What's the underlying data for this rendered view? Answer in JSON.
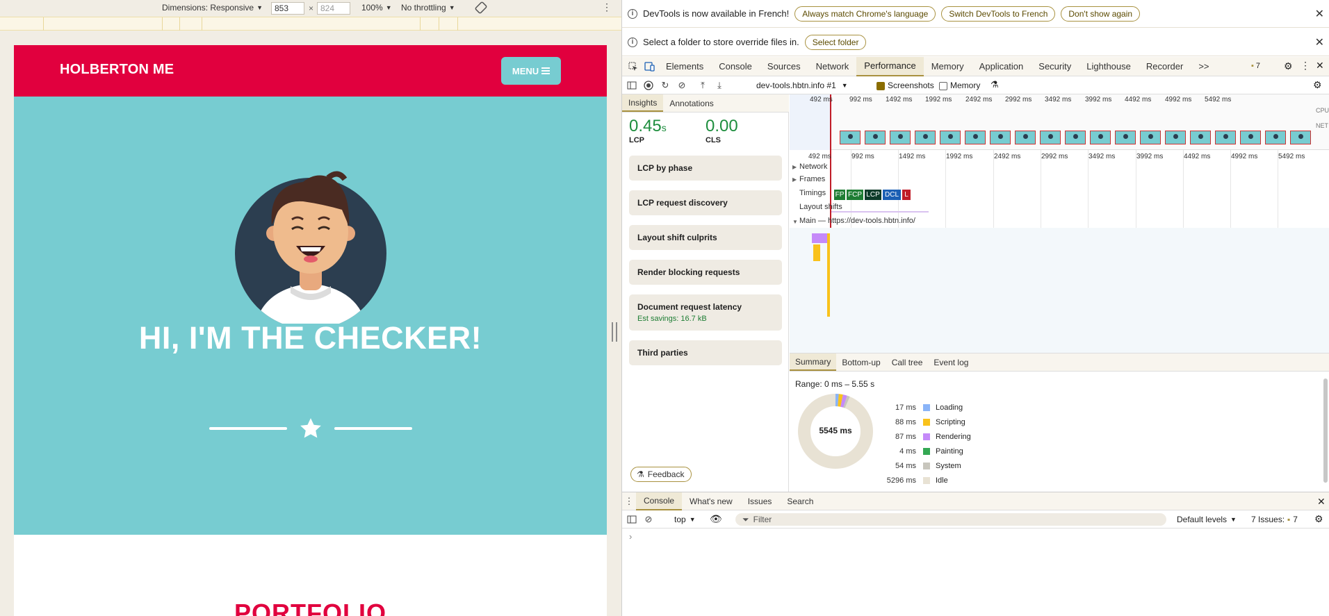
{
  "device_toolbar": {
    "dimensions_label": "Dimensions: Responsive",
    "width": "853",
    "times": "×",
    "height_placeholder": "824",
    "zoom": "100%",
    "throttling": "No throttling"
  },
  "site": {
    "logo": "HOLBERTON ME",
    "menu_label": "MENU",
    "hero_title": "HI, I'M THE CHECKER!",
    "section_title": "PORTFOLIO",
    "colors": {
      "brand_red": "#e1003e",
      "teal": "#77ccd1"
    }
  },
  "devtools": {
    "info_bars": [
      {
        "text": "DevTools is now available in French!",
        "buttons": [
          "Always match Chrome's language",
          "Switch DevTools to French",
          "Don't show again"
        ]
      },
      {
        "text": "Select a folder to store override files in.",
        "buttons": [
          "Select folder"
        ]
      }
    ],
    "tabs": [
      "Elements",
      "Console",
      "Sources",
      "Network",
      "Performance",
      "Memory",
      "Application",
      "Security",
      "Lighthouse",
      "Recorder"
    ],
    "active_tab": "Performance",
    "more_tabs": ">>",
    "issues_count": "7",
    "perf_toolbar": {
      "recording": "dev-tools.hbtn.info #1",
      "screenshots_label": "Screenshots",
      "memory_label": "Memory",
      "screenshots_checked": true,
      "memory_checked": false
    },
    "insights": {
      "tabs": [
        "Insights",
        "Annotations"
      ],
      "lcp": {
        "value": "0.45",
        "unit": "s",
        "label": "LCP"
      },
      "cls": {
        "value": "0.00",
        "label": "CLS"
      },
      "cards": [
        {
          "title": "LCP by phase"
        },
        {
          "title": "LCP request discovery"
        },
        {
          "title": "Layout shift culprits"
        },
        {
          "title": "Render blocking requests"
        },
        {
          "title": "Document request latency",
          "sub": "Est savings: 16.7 kB"
        },
        {
          "title": "Third parties"
        }
      ],
      "feedback": "Feedback"
    },
    "timeline": {
      "overview_ticks": [
        "492 ms",
        "992 ms",
        "1492 ms",
        "1992 ms",
        "2492 ms",
        "2992 ms",
        "3492 ms",
        "3992 ms",
        "4492 ms",
        "4992 ms",
        "5492 ms"
      ],
      "cpu_label": "CPU",
      "net_label": "NET",
      "ticks": [
        "492 ms",
        "992 ms",
        "1492 ms",
        "1992 ms",
        "2492 ms",
        "2992 ms",
        "3492 ms",
        "3992 ms",
        "4492 ms",
        "4992 ms",
        "5492 ms"
      ],
      "tracks": {
        "network": "Network",
        "frames": "Frames",
        "timings": "Timings",
        "layout_shifts": "Layout shifts",
        "main": "Main — https://dev-tools.hbtn.info/"
      },
      "timings": [
        {
          "label": "FP",
          "color": "#1e7d34"
        },
        {
          "label": "FCP",
          "color": "#1e7d34"
        },
        {
          "label": "LCP",
          "color": "#0d3b2a"
        },
        {
          "label": "DCL",
          "color": "#1a5fb4"
        },
        {
          "label": "L",
          "color": "#c01c28"
        }
      ]
    },
    "summary": {
      "tabs": [
        "Summary",
        "Bottom-up",
        "Call tree",
        "Event log"
      ],
      "range": "Range: 0 ms – 5.55 s",
      "total": "5545 ms",
      "legend": [
        {
          "ms": "17 ms",
          "label": "Loading",
          "color": "#8ab4f8"
        },
        {
          "ms": "88 ms",
          "label": "Scripting",
          "color": "#f9c21b"
        },
        {
          "ms": "87 ms",
          "label": "Rendering",
          "color": "#c58af9"
        },
        {
          "ms": "4 ms",
          "label": "Painting",
          "color": "#34a853"
        },
        {
          "ms": "54 ms",
          "label": "System",
          "color": "#c8c6bd"
        },
        {
          "ms": "5296 ms",
          "label": "Idle",
          "color": "#e8e2d4"
        }
      ]
    },
    "drawer": {
      "tabs": [
        "Console",
        "What's new",
        "Issues",
        "Search"
      ],
      "context": "top",
      "filter_placeholder": "Filter",
      "levels": "Default levels",
      "issues": "7 Issues:",
      "issues_count": "7",
      "prompt": "›"
    }
  }
}
